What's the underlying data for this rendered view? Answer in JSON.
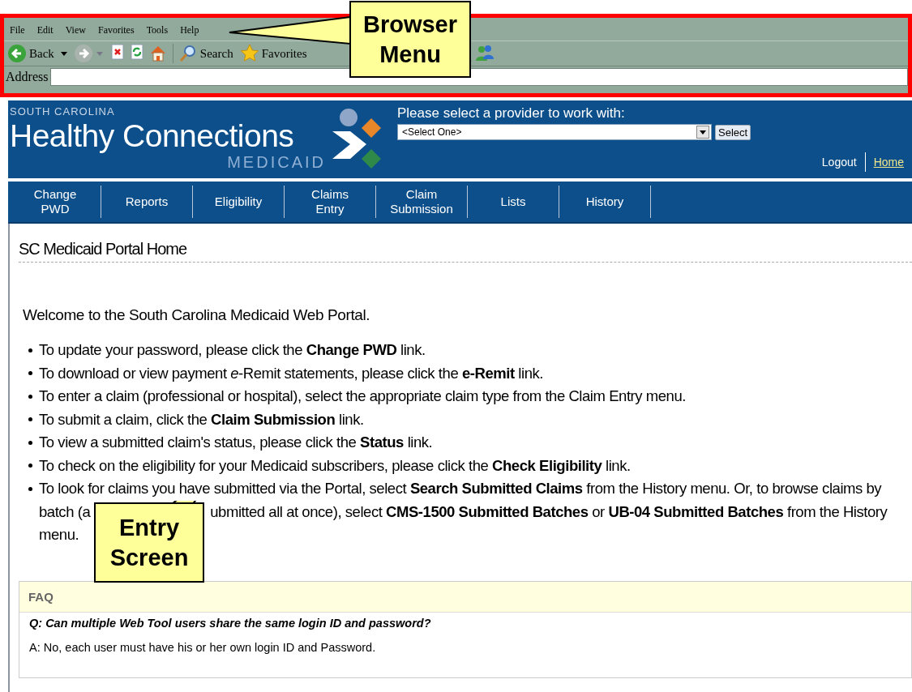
{
  "browser": {
    "menu": [
      "File",
      "Edit",
      "View",
      "Favorites",
      "Tools",
      "Help"
    ],
    "toolbar": [
      {
        "kind": "back",
        "label": "Back"
      },
      {
        "kind": "forward"
      },
      {
        "kind": "stop"
      },
      {
        "kind": "refresh"
      },
      {
        "kind": "home"
      },
      {
        "kind": "search",
        "label": "Search"
      },
      {
        "kind": "favorites",
        "label": "Favorites"
      },
      {
        "kind": "research"
      },
      {
        "kind": "messenger"
      }
    ],
    "address_label": "Address"
  },
  "header": {
    "state": "SOUTH CAROLINA",
    "brand": "Healthy Connections",
    "program": "MEDICAID",
    "provider_prompt": "Please select a provider to work with:",
    "provider_select": "<Select One>",
    "select_button": "Select",
    "links": [
      {
        "label": "Logout",
        "kind": "plain"
      },
      {
        "label": "Home",
        "kind": "link"
      }
    ]
  },
  "nav": [
    {
      "lines": [
        "Change",
        "PWD"
      ]
    },
    {
      "lines": [
        "Reports"
      ]
    },
    {
      "lines": [
        "Eligibility"
      ]
    },
    {
      "lines": [
        "Claims",
        "Entry"
      ]
    },
    {
      "lines": [
        "Claim",
        "Submission"
      ]
    },
    {
      "lines": [
        "Lists"
      ]
    },
    {
      "lines": [
        "History"
      ]
    }
  ],
  "page": {
    "title": "SC Medicaid Portal Home",
    "intro": "Welcome to the South Carolina Medicaid Web Portal.",
    "bullets": [
      {
        "kind": "text",
        "text": "To update your password, please click the **Change PWD** link."
      },
      {
        "kind": "text",
        "text": "To download or view payment *e*-Remit statements, please click the **e-Remit** link."
      },
      {
        "kind": "text",
        "text": "To enter a claim (professional or hospital), select the appropriate claim type from the Claim Entry menu."
      },
      {
        "kind": "text",
        "text": "To submit a claim, click the **Claim Submission** link."
      },
      {
        "kind": "text",
        "text": "To view a submitted claim's status, please click the **Status** link."
      },
      {
        "kind": "text",
        "text": "To check on the eligibility for your Medicaid subscribers, please click the **Check Eligibility** link."
      },
      {
        "kind": "split",
        "lines": [
          [
            "To look for claims you have submitted via the Portal, select **Search Submitted Claims** from the History menu. Or, to browse claims by"
          ],
          [
            "batch (a",
            "ubmitted all at once), select **CMS-1500 Submitted Batches** or **UB-04 Submitted Batches** from the History"
          ],
          [
            "menu."
          ]
        ]
      }
    ]
  },
  "faq": {
    "heading": "FAQ",
    "question": "Q: Can multiple  Web Tool users share the same login ID and password?",
    "answer": "A: No, each user must have his or her own login ID and Password."
  },
  "callouts": [
    {
      "kind": "browser",
      "lines": [
        "Browser",
        "Menu"
      ]
    },
    {
      "kind": "entry",
      "lines": [
        "Entry",
        "Screen"
      ]
    }
  ]
}
